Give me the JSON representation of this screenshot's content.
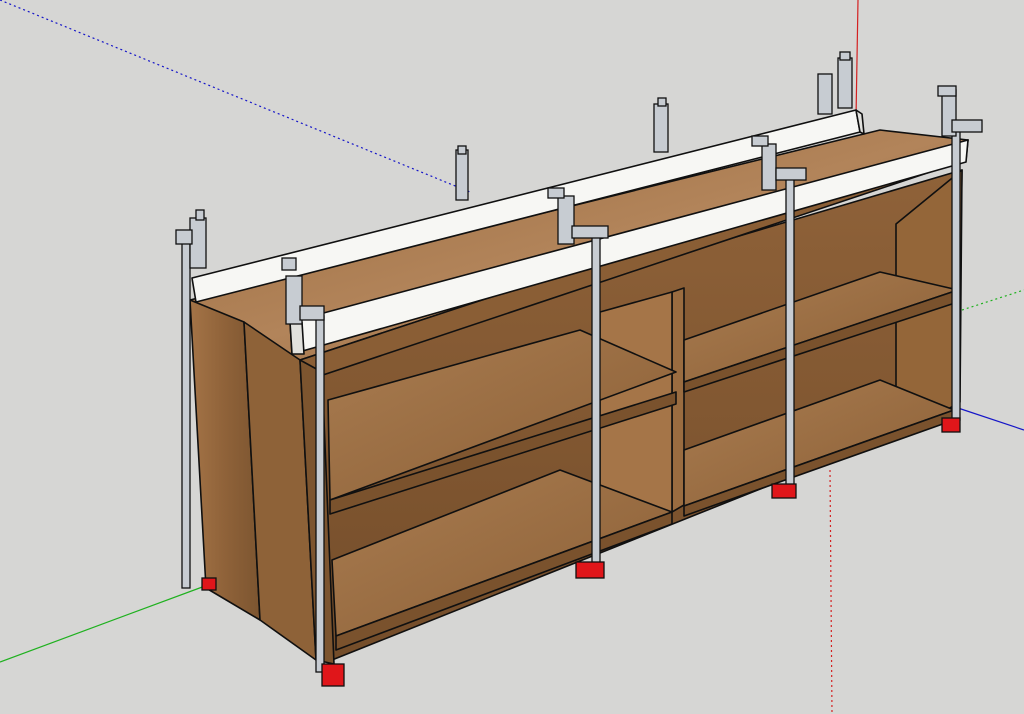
{
  "scene": {
    "background": "#d6d6d4",
    "colors": {
      "axis_red": "#d42020",
      "axis_green": "#1fb11f",
      "axis_blue": "#1616c8",
      "wood_light": "#a6784a",
      "wood_mid": "#8d6138",
      "wood_dark": "#6f4a28",
      "trim_white": "#f7f7f4",
      "clamp_gray": "#c7ccd2",
      "clamp_pad": "#e0161a",
      "edge": "#101010"
    },
    "objects": [
      "cabinet-carcass",
      "shelf",
      "caul-board",
      "bar-clamp",
      "axis-line"
    ]
  }
}
